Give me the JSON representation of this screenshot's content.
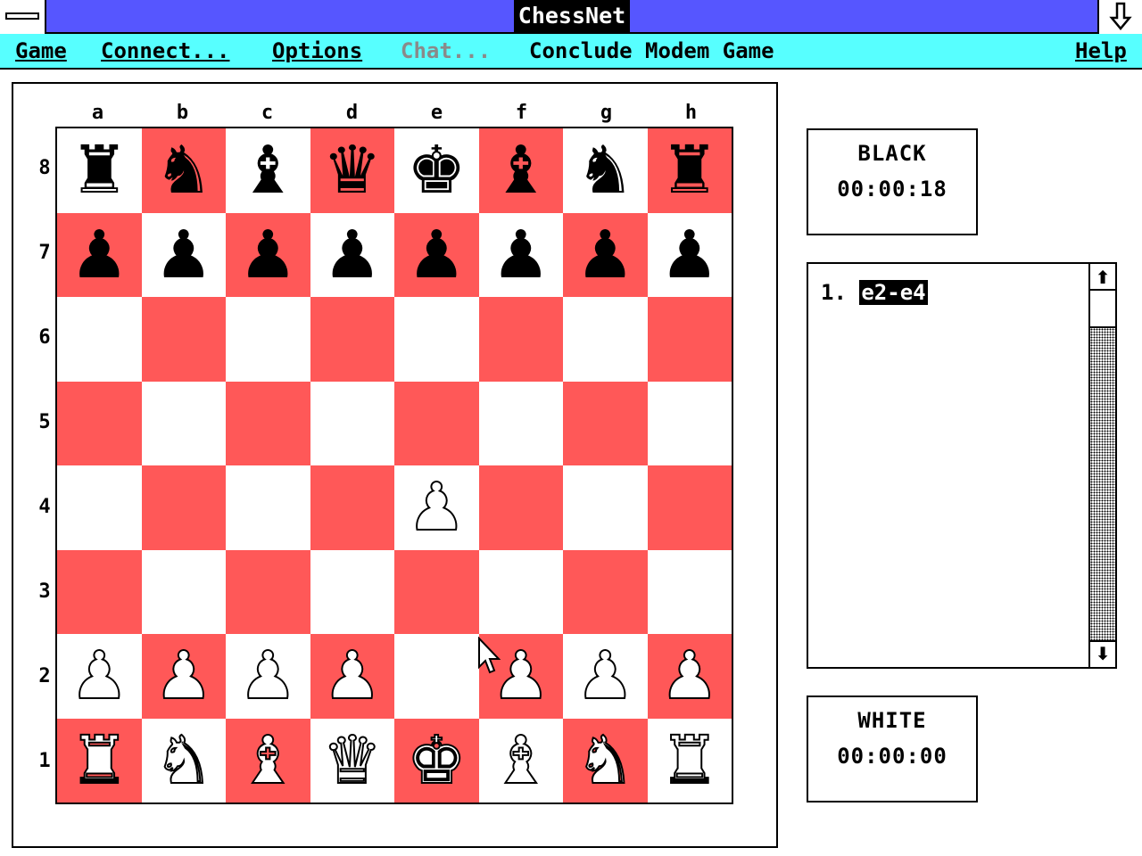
{
  "window": {
    "title": "ChessNet"
  },
  "menu": {
    "game": "Game",
    "connect": "Connect...",
    "options": "Options",
    "chat": "Chat...",
    "conclude": "Conclude Modem Game",
    "help": "Help"
  },
  "board": {
    "files": [
      "a",
      "b",
      "c",
      "d",
      "e",
      "f",
      "g",
      "h"
    ],
    "ranks": [
      "8",
      "7",
      "6",
      "5",
      "4",
      "3",
      "2",
      "1"
    ],
    "position": [
      [
        "bR",
        "bN",
        "bB",
        "bQ",
        "bK",
        "bB",
        "bN",
        "bR"
      ],
      [
        "bP",
        "bP",
        "bP",
        "bP",
        "bP",
        "bP",
        "bP",
        "bP"
      ],
      [
        "",
        "",
        "",
        "",
        "",
        "",
        "",
        ""
      ],
      [
        "",
        "",
        "",
        "",
        "",
        "",
        "",
        ""
      ],
      [
        "",
        "",
        "",
        "",
        "wP",
        "",
        "",
        ""
      ],
      [
        "",
        "",
        "",
        "",
        "",
        "",
        "",
        ""
      ],
      [
        "wP",
        "wP",
        "wP",
        "wP",
        "",
        "wP",
        "wP",
        "wP"
      ],
      [
        "wR",
        "wN",
        "wB",
        "wQ",
        "wK",
        "wB",
        "wN",
        "wR"
      ]
    ]
  },
  "colors": {
    "light_square": "#ffffff",
    "dark_square": "#ff5858",
    "menu_bg": "#57ffff",
    "title_bg": "#5656ff"
  },
  "black_clock": {
    "name": "BLACK",
    "time": "00:00:18"
  },
  "white_clock": {
    "name": "WHITE",
    "time": "00:00:00"
  },
  "move_list": {
    "number": "1.",
    "move": "e2-e4"
  },
  "icons": {
    "system_menu": "system-menu-icon",
    "minimize": "minimize-arrow-icon",
    "scroll_up": "scroll-up-arrow-icon",
    "scroll_down": "scroll-down-arrow-icon",
    "pointer": "mouse-pointer-icon"
  }
}
